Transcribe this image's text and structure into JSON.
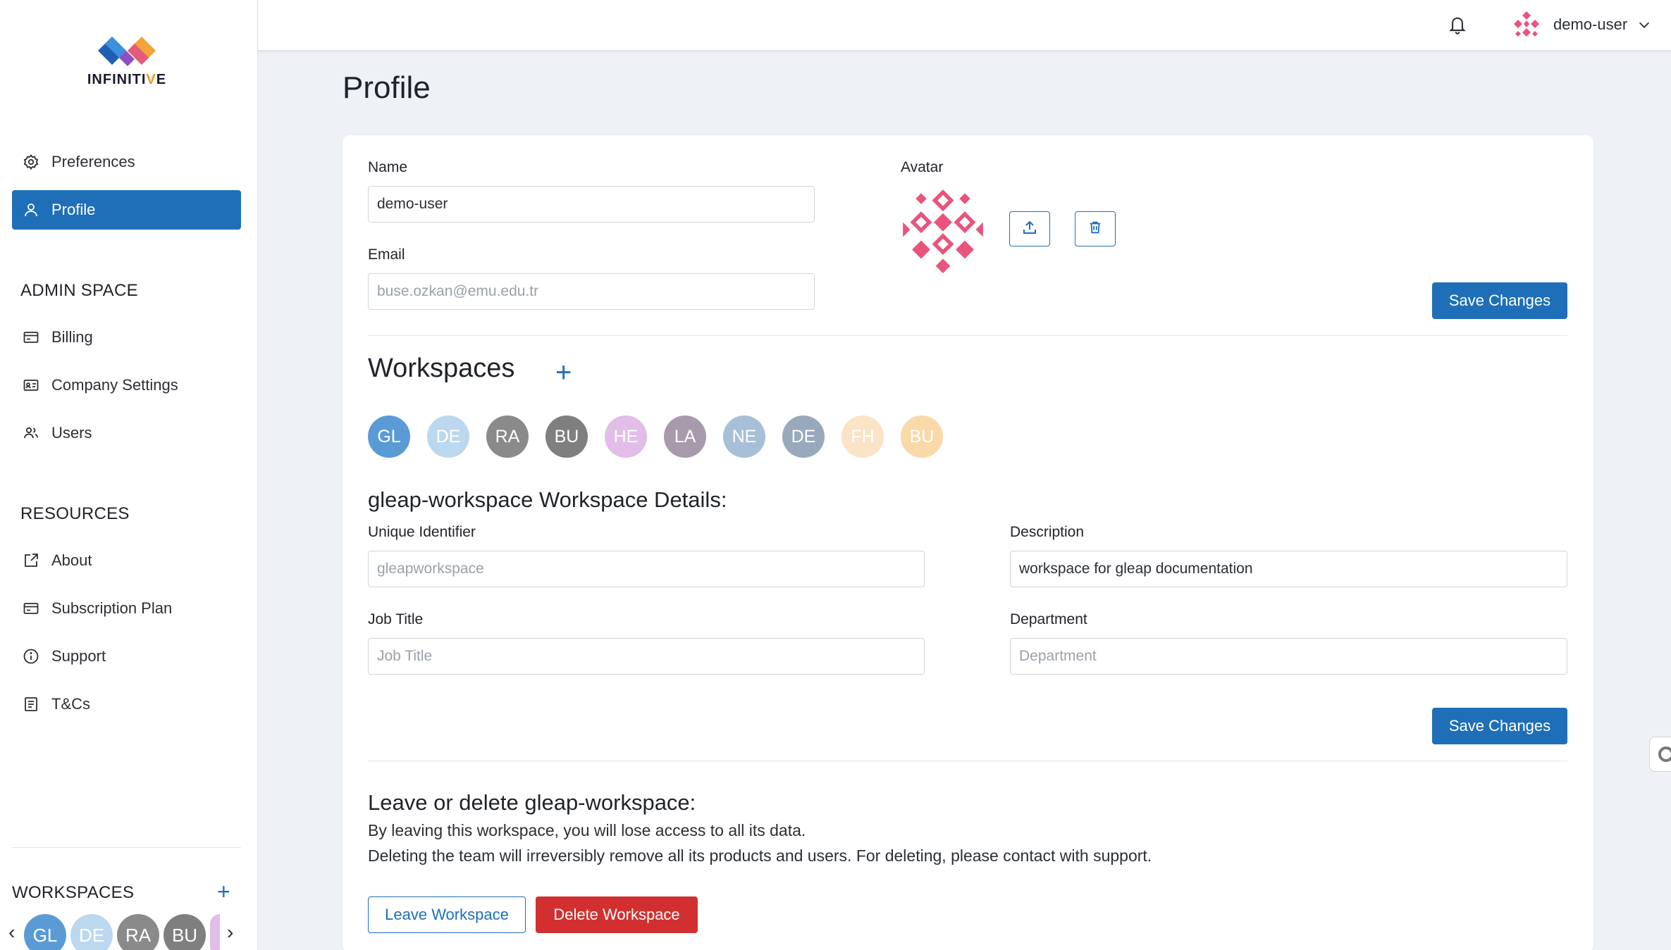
{
  "brand": {
    "name_prefix": "INFINITI",
    "name_accent": "V",
    "name_suffix": "E"
  },
  "sidebar": {
    "top_items": [
      {
        "label": "Preferences",
        "icon": "gear-icon"
      },
      {
        "label": "Profile",
        "icon": "user-icon",
        "active": true
      }
    ],
    "admin_title": "ADMIN SPACE",
    "admin_items": [
      {
        "label": "Billing",
        "icon": "card-icon"
      },
      {
        "label": "Company Settings",
        "icon": "id-card-icon"
      },
      {
        "label": "Users",
        "icon": "users-icon"
      }
    ],
    "resources_title": "RESOURCES",
    "resource_items": [
      {
        "label": "About",
        "icon": "external-link-icon"
      },
      {
        "label": "Subscription Plan",
        "icon": "card-icon"
      },
      {
        "label": "Support",
        "icon": "info-icon"
      },
      {
        "label": "T&Cs",
        "icon": "document-icon"
      }
    ],
    "workspaces_title": "WORKSPACES",
    "workspaces_add": "+",
    "mini_workspaces": [
      "GL",
      "DE",
      "RA",
      "BU"
    ],
    "prev_arrow": "‹",
    "next_arrow": "›"
  },
  "topbar": {
    "username": "demo-user"
  },
  "page": {
    "title": "Profile"
  },
  "profile": {
    "name_label": "Name",
    "name_value": "demo-user",
    "email_label": "Email",
    "email_value": "buse.ozkan@emu.edu.tr",
    "avatar_label": "Avatar",
    "save_label": "Save Changes"
  },
  "workspaces": {
    "title": "Workspaces",
    "add": "+",
    "items": [
      {
        "initials": "GL",
        "color": "#5b9bd5"
      },
      {
        "initials": "DE",
        "color": "#bcd8ef"
      },
      {
        "initials": "RA",
        "color": "#8a8a8a"
      },
      {
        "initials": "BU",
        "color": "#7f7f7f"
      },
      {
        "initials": "HE",
        "color": "#e2bde8"
      },
      {
        "initials": "LA",
        "color": "#a89aad"
      },
      {
        "initials": "NE",
        "color": "#a7c0d8"
      },
      {
        "initials": "DE",
        "color": "#98a9bc"
      },
      {
        "initials": "FH",
        "color": "#fbe3c6"
      },
      {
        "initials": "BU",
        "color": "#f9d9a8"
      }
    ]
  },
  "details": {
    "title": "gleap-workspace Workspace Details:",
    "uid_label": "Unique Identifier",
    "uid_value": "gleapworkspace",
    "desc_label": "Description",
    "desc_value": "workspace for gleap documentation",
    "job_label": "Job Title",
    "job_placeholder": "Job Title",
    "dept_label": "Department",
    "dept_placeholder": "Department",
    "save_label": "Save Changes"
  },
  "danger": {
    "title": "Leave or delete gleap-workspace:",
    "line1": "By leaving this workspace, you will lose access to all its data.",
    "line2": "Deleting the team will irreversibly remove all its products and users. For deleting, please contact with support.",
    "leave_label": "Leave Workspace",
    "delete_label": "Delete Workspace"
  },
  "colors": {
    "primary": "#1f6fb8",
    "danger": "#d23030",
    "avatar_pink": "#e8547c"
  }
}
